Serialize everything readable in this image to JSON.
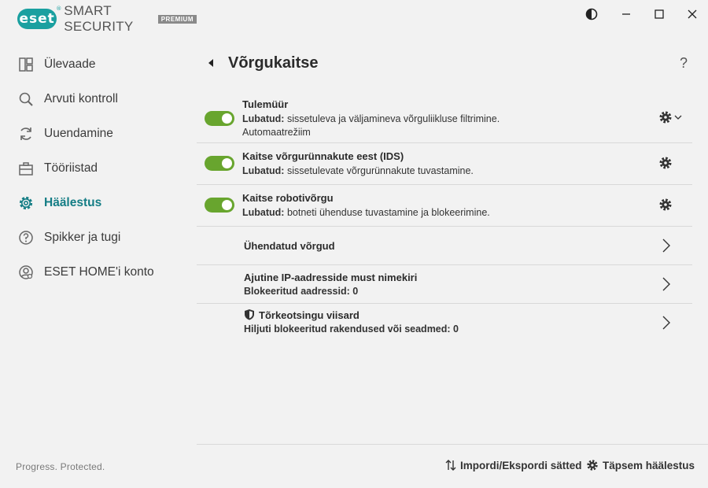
{
  "app": {
    "logo_text": "eset",
    "product": "SMART SECURITY",
    "edition": "PREMIUM",
    "tagline": "Progress. Protected."
  },
  "sidebar": {
    "items": [
      {
        "label": "Ülevaade",
        "icon": "overview-icon",
        "active": false
      },
      {
        "label": "Arvuti kontroll",
        "icon": "scan-icon",
        "active": false
      },
      {
        "label": "Uuendamine",
        "icon": "update-icon",
        "active": false
      },
      {
        "label": "Tööriistad",
        "icon": "tools-icon",
        "active": false
      },
      {
        "label": "Häälestus",
        "icon": "setup-icon",
        "active": true
      },
      {
        "label": "Spikker ja tugi",
        "icon": "help-icon",
        "active": false
      },
      {
        "label": "ESET HOME'i konto",
        "icon": "account-icon",
        "active": false
      }
    ]
  },
  "header": {
    "title": "Võrgukaitse",
    "help": "?"
  },
  "rows": {
    "firewall": {
      "title": "Tulemüür",
      "status": "Lubatud:",
      "desc": " sissetuleva ja väljamineva võrguliikluse filtrimine.",
      "sub": "Automaatrežiim",
      "enabled": true
    },
    "ids": {
      "title": "Kaitse võrgurünnakute eest (IDS)",
      "status": "Lubatud:",
      "desc": " sissetulevate võrgurünnakute tuvastamine.",
      "enabled": true
    },
    "botnet": {
      "title": "Kaitse robotivõrgu",
      "status": "Lubatud:",
      "desc": " botneti ühenduse tuvastamine ja blokeerimine.",
      "enabled": true
    },
    "networks": {
      "title": "Ühendatud võrgud"
    },
    "blacklist": {
      "title": "Ajutine IP-aadresside must nimekiri",
      "sub": "Blokeeritud aadressid: 0"
    },
    "troubleshoot": {
      "title": "Tõrkeotsingu viisard",
      "sub": "Hiljuti blokeeritud rakendused või seadmed: 0"
    }
  },
  "footer": {
    "import_export": "Impordi/Ekspordi sätted",
    "advanced": "Täpsem häälestus"
  },
  "colors": {
    "accent": "#147d85",
    "toggle_on": "#68a52e",
    "logo": "#1aa0a0"
  }
}
